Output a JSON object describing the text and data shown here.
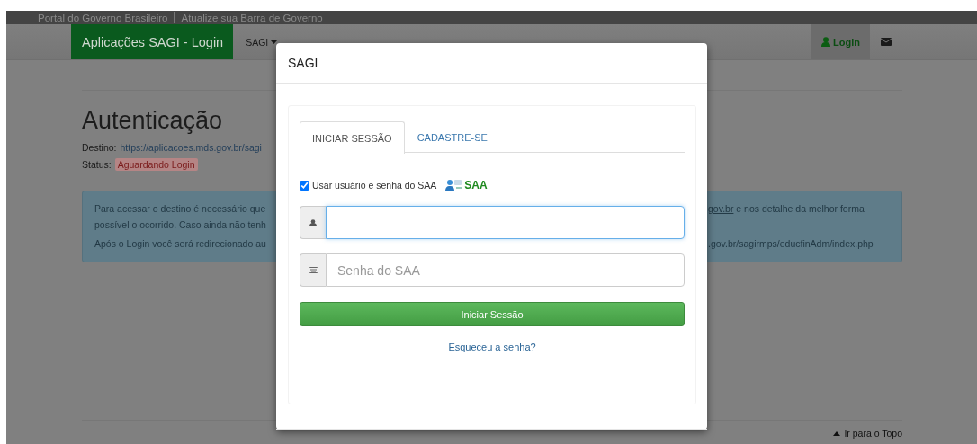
{
  "gov_bar": {
    "links": [
      "Portal do Governo Brasileiro",
      "Atualize sua Barra de Governo"
    ]
  },
  "navbar": {
    "brand": "Aplicações SAGI - Login",
    "menu": [
      {
        "label": "SAGI",
        "has_caret": true
      }
    ],
    "right": [
      {
        "kind": "login",
        "label": "Login",
        "selected": true
      },
      {
        "kind": "mail"
      }
    ]
  },
  "page": {
    "heading": "Autenticação",
    "destination": {
      "label": "Destino:",
      "url": "https://aplicacoes.mds.gov.br/sagi"
    },
    "status": {
      "label": "Status:",
      "badge": "Aguardando Login"
    },
    "alert": {
      "rows": [
        {
          "left": "Para acessar o destino é necessário que",
          "right_link": "gov.br",
          "right": " e nos detalhe da melhor forma"
        },
        {
          "left": "possível o ocorrido. Caso ainda não tenh"
        },
        {
          "left": "Após o Login você será redirecionado au",
          "right": ".gov.br/sagirmps/educfinAdm/index.php"
        }
      ]
    },
    "back_to_top": "Ir para o Topo"
  },
  "modal": {
    "title": "SAGI",
    "tabs": [
      {
        "label": "INICIAR SESSÃO",
        "selected": true
      },
      {
        "label": "CADASTRE-SE",
        "selected": false
      }
    ],
    "use_saa": {
      "label": "Usar usuário e senha do SAA",
      "checked": true,
      "logo": "SAA"
    },
    "fields": [
      {
        "kind": "user",
        "focused": true
      },
      {
        "kind": "password",
        "placeholder": "Senha do SAA",
        "focused": false
      }
    ],
    "submit": "Iniciar Sessão",
    "forgot": "Esqueceu a senha?"
  }
}
